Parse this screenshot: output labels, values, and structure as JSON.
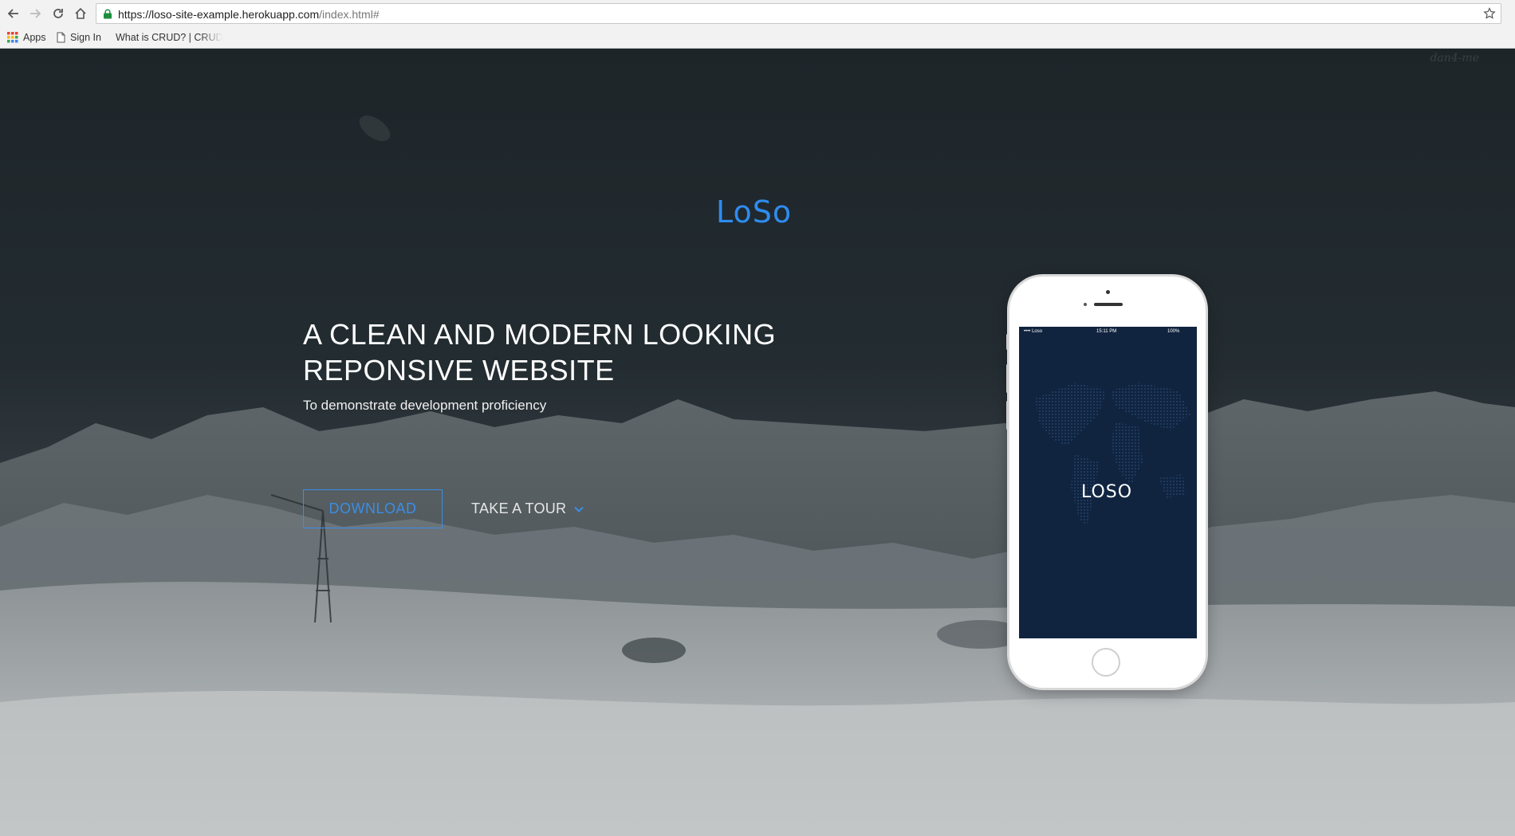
{
  "browser": {
    "url_host": "https://loso-site-example.herokuapp.com",
    "url_path": "/index.html#",
    "bookmarks": [
      {
        "label": "Apps"
      },
      {
        "label": "Sign In"
      },
      {
        "label": "What is CRUD? | CRUD"
      }
    ]
  },
  "page": {
    "watermark": "dan4-me",
    "logo": "LoSo",
    "headline_line1": "A CLEAN AND MODERN LOOKING",
    "headline_line2": "REPONSIVE WEBSITE",
    "subheadline": "To demonstrate development proficiency",
    "download_label": "DOWNLOAD",
    "tour_label": "TAKE A TOUR"
  },
  "phone": {
    "carrier": "•••• Loso",
    "time": "15:11 PM",
    "battery": "100%",
    "screen_logo": "LOSO"
  },
  "colors": {
    "accent": "#2e8cf0",
    "phone_screen": "#102440"
  },
  "icons": [
    "back-icon",
    "forward-icon",
    "reload-icon",
    "home-icon",
    "lock-icon",
    "star-icon",
    "apps-grid-icon",
    "page-icon",
    "crud-favicon",
    "chevron-down-icon"
  ]
}
